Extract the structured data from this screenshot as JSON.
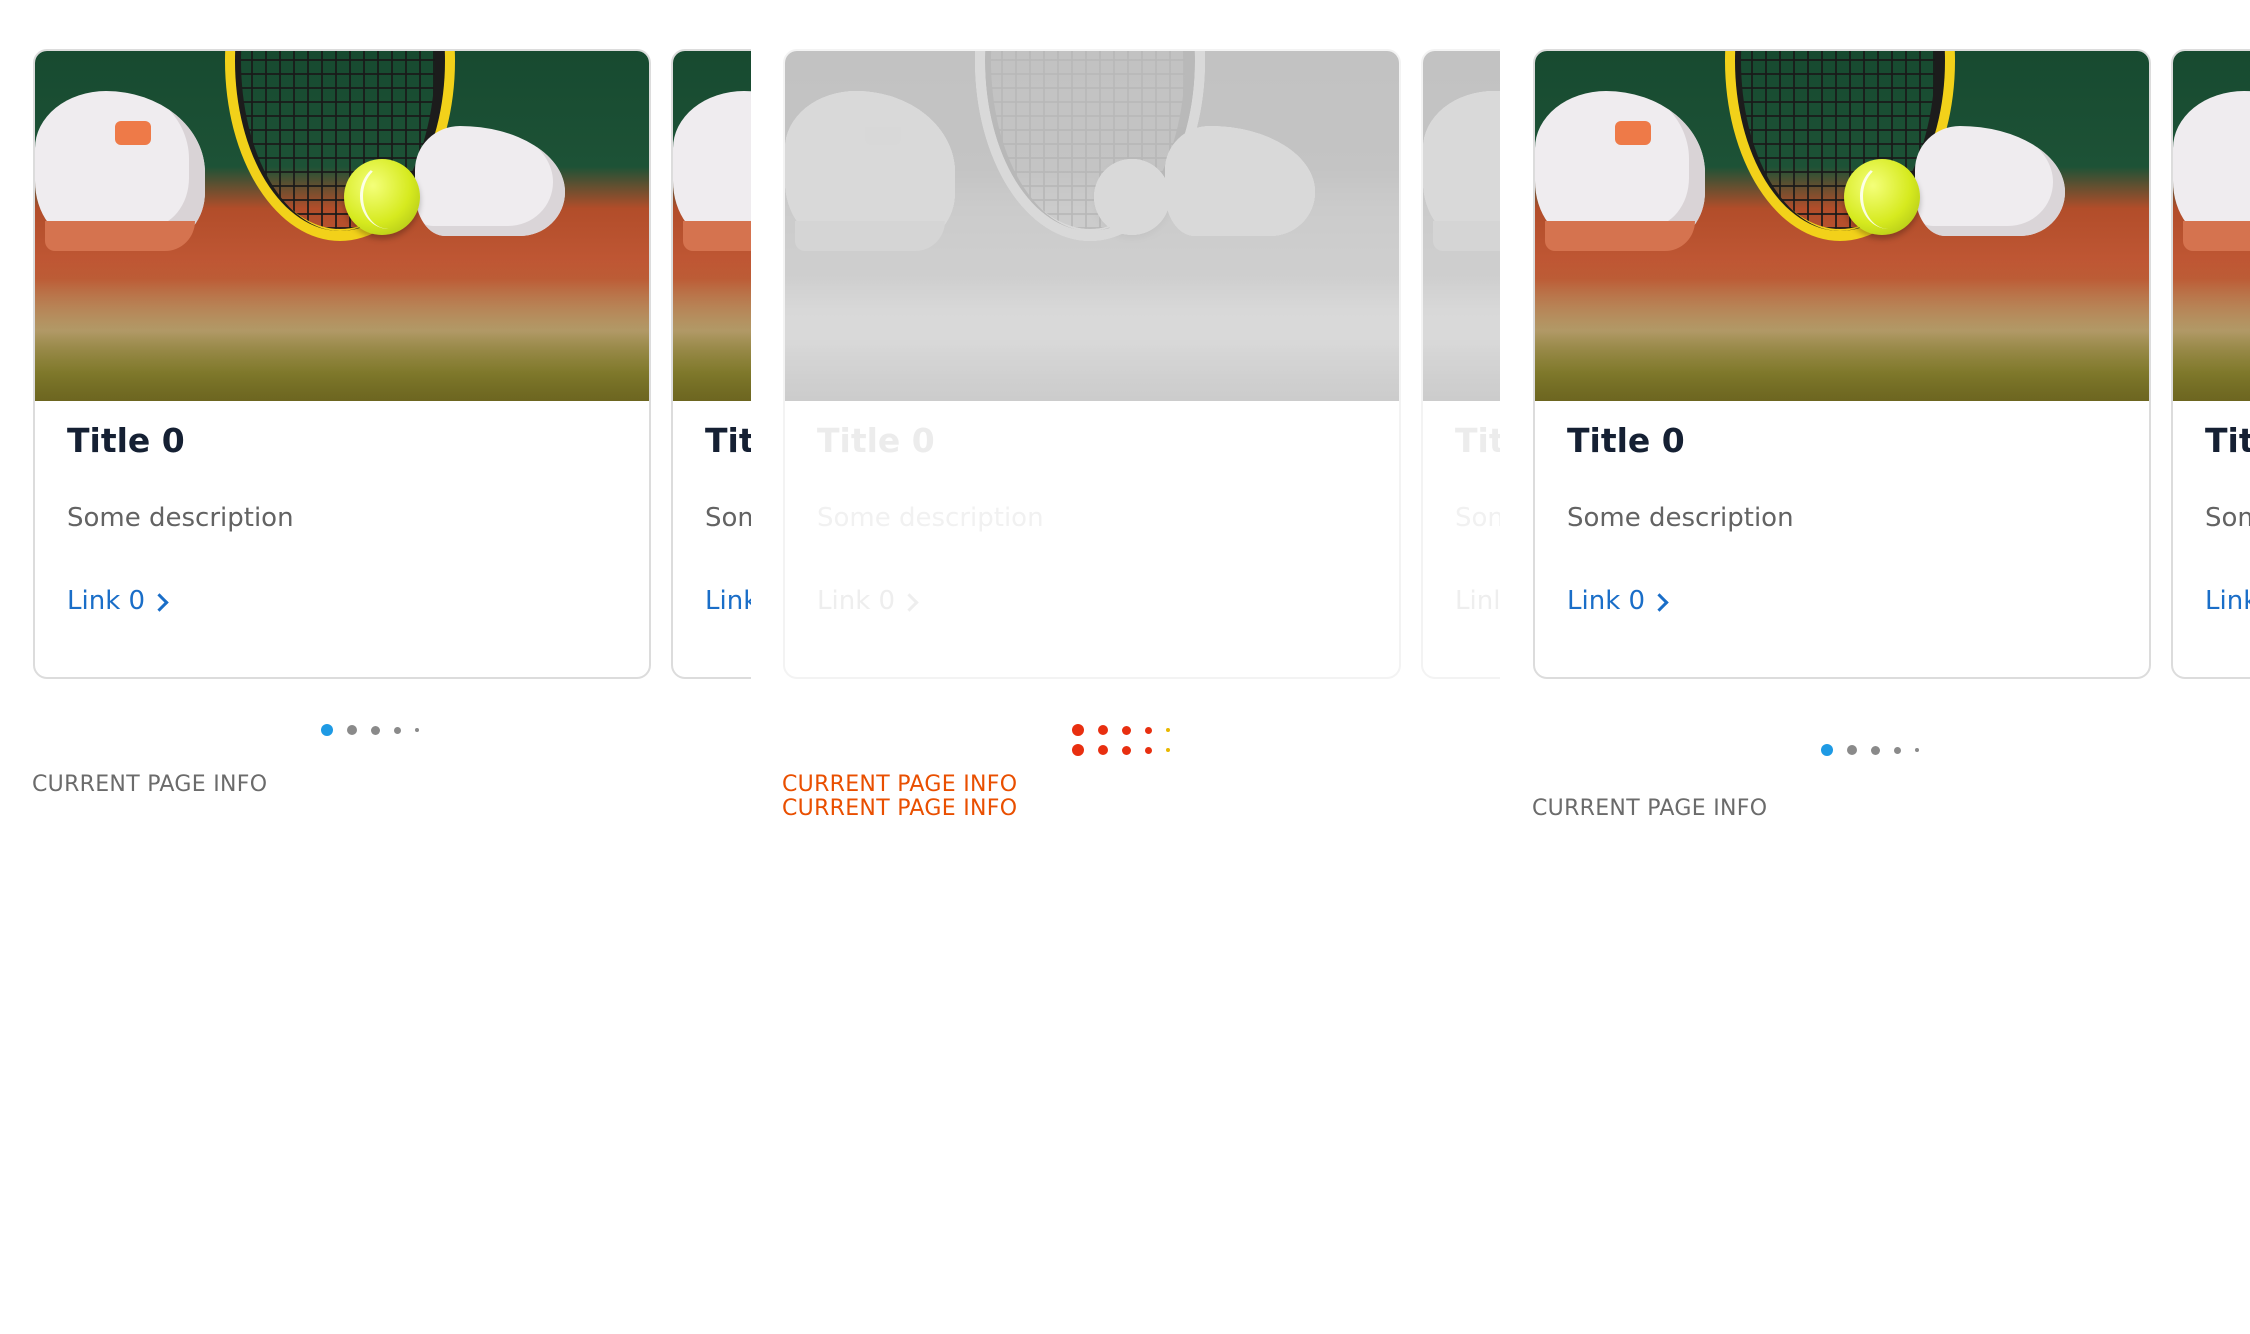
{
  "carousels": [
    {
      "cards": [
        {
          "title": "Title 0",
          "description": "Some description",
          "link": "Link 0",
          "image_alt": "tennis racket and ball on clay court"
        },
        {
          "title": "Tit",
          "description": "Som",
          "link": "Link"
        }
      ],
      "page_info": [
        "CURRENT PAGE INFO"
      ],
      "dot_count": 5,
      "active_dot": 0
    },
    {
      "cards": [
        {
          "title": "Title 0",
          "description": "Some description",
          "link": "Link 0"
        },
        {
          "title": "Tit",
          "description": "Son",
          "link": "Linl"
        }
      ],
      "page_info": [
        "CURRENT PAGE INFO",
        "CURRENT PAGE INFO"
      ],
      "dot_count": 5,
      "dot_rows": 2
    },
    {
      "cards": [
        {
          "title": "Title 0",
          "description": "Some description",
          "link": "Link 0"
        },
        {
          "title": "Tit",
          "description": "Som",
          "link": "Link"
        }
      ],
      "page_info": [
        "CURRENT PAGE INFO"
      ],
      "dot_count": 5,
      "active_dot": 0
    }
  ],
  "colors": {
    "active_dot": "#1e9ae4",
    "inactive_dot": "#8a8a8a",
    "link": "#1a6ec8",
    "title": "#152033",
    "alert_dot": "#e82f10",
    "alert_text": "#e94f00"
  },
  "icons": {
    "link_arrow": "chevron-right-icon"
  }
}
